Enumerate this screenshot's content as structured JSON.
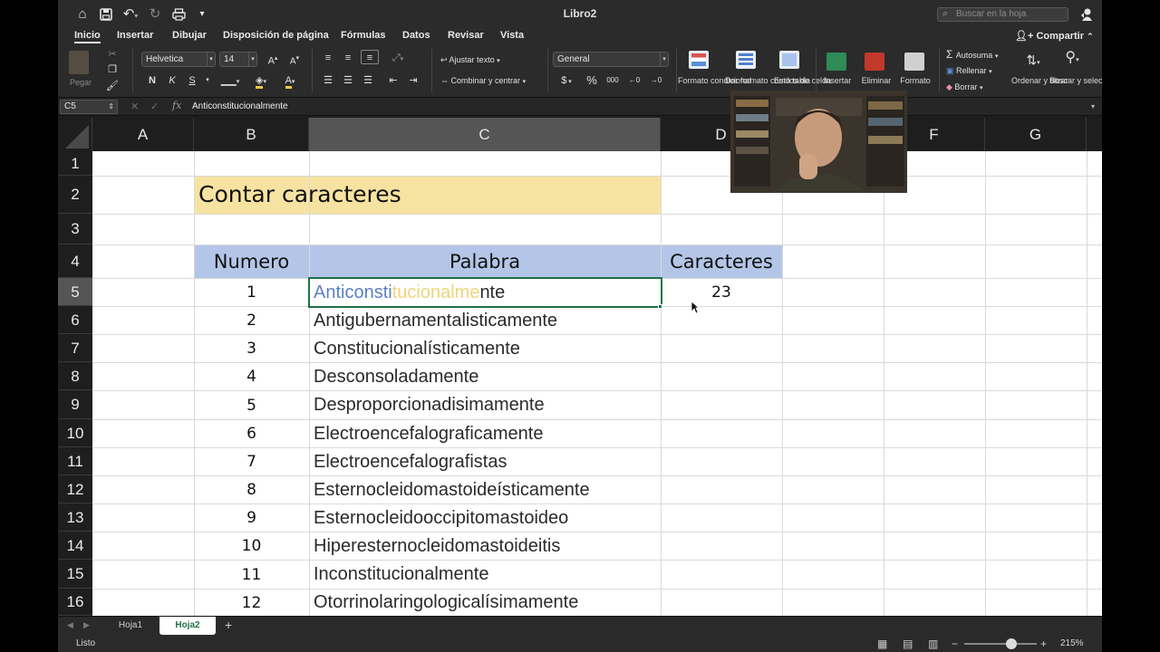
{
  "window": {
    "title": "Libro2",
    "search_placeholder": "Buscar en la hoja"
  },
  "tabs": [
    "Inicio",
    "Insertar",
    "Dibujar",
    "Disposición de página",
    "Fórmulas",
    "Datos",
    "Revisar",
    "Vista"
  ],
  "active_tab": "Inicio",
  "share_label": "Compartir",
  "ribbon": {
    "paste_label": "Pegar",
    "font_name": "Helvetica",
    "font_size": "14",
    "bold": "N",
    "italic": "K",
    "underline": "S",
    "wrap_text": "Ajustar texto",
    "merge_center": "Combinar y centrar",
    "number_format": "General",
    "currency": "$",
    "percent": "%",
    "thousands": "000",
    "conditional_format": "Formato condicional",
    "format_table": "Dar formato como tabla",
    "cell_styles": "Estilos de celda",
    "insert": "Insertar",
    "delete": "Eliminar",
    "format": "Formato",
    "autosum": "Autosuma",
    "fill": "Rellenar",
    "clear": "Borrar",
    "sort_filter": "Ordenar y filtrar",
    "find_select": "Buscar y seleccionar"
  },
  "formula_bar": {
    "cell_ref": "C5",
    "value": "Anticonstitucionalmente"
  },
  "columns": [
    "A",
    "B",
    "C",
    "D",
    "F",
    "G"
  ],
  "selected_column": "C",
  "rows": [
    "1",
    "2",
    "3",
    "4",
    "5",
    "6",
    "7",
    "8",
    "9",
    "10",
    "11",
    "12",
    "13",
    "14",
    "15",
    "16"
  ],
  "selected_row": "5",
  "sheet": {
    "title": "Contar caracteres",
    "headers": {
      "numero": "Numero",
      "palabra": "Palabra",
      "caracteres": "Caracteres"
    },
    "data": [
      {
        "n": "1",
        "word": "Anticonstitucionalmente",
        "chars": "23"
      },
      {
        "n": "2",
        "word": "Antigubernamentalisticamente",
        "chars": ""
      },
      {
        "n": "3",
        "word": "Constitucionalísticamente",
        "chars": ""
      },
      {
        "n": "4",
        "word": "Desconsoladamente",
        "chars": ""
      },
      {
        "n": "5",
        "word": "Desproporcionadisimamente",
        "chars": ""
      },
      {
        "n": "6",
        "word": "Electroencefalograficamente",
        "chars": ""
      },
      {
        "n": "7",
        "word": "Electroencefalografistas",
        "chars": ""
      },
      {
        "n": "8",
        "word": "Esternocleidomastoideísticamente",
        "chars": ""
      },
      {
        "n": "9",
        "word": "Esternocleidooccipitomastoideo",
        "chars": ""
      },
      {
        "n": "10",
        "word": "Hiperesternocleidomastoideitis",
        "chars": ""
      },
      {
        "n": "11",
        "word": "Inconstitucionalmente",
        "chars": ""
      },
      {
        "n": "12",
        "word": "Otorrinolaringologicalísimamente",
        "chars": ""
      }
    ],
    "highlight_word_parts": [
      "Anticonsti",
      "tucionalme",
      "nte"
    ]
  },
  "sheet_tabs": [
    "Hoja1",
    "Hoja2"
  ],
  "active_sheet": "Hoja2",
  "status": {
    "text": "Listo",
    "zoom": "215%",
    "zoom_fraction": 0.65
  },
  "colors": {
    "title_fill": "#f7e3a1",
    "header_fill": "#b4c6e7",
    "selection": "#1e7145",
    "highlight_blue": "#5b7fc4",
    "highlight_yellow": "#efd47a"
  }
}
